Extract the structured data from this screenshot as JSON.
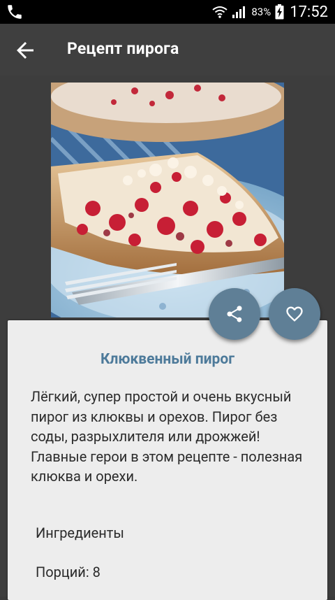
{
  "status_bar": {
    "battery_percent": "83%",
    "time": "17:52"
  },
  "appbar": {
    "title": "Рецепт пирога"
  },
  "recipe": {
    "title": "Клюквенный пирог",
    "description": "Лёгкий, супер простой и очень вкусный пирог из клюквы и орехов. Пирог без соды, разрыхлителя или дрожжей! Главные герои в этом рецепте - полезная клюква и орехи.",
    "ingredients_label": "Ингредиенты",
    "servings_label": "Порций: 8"
  },
  "colors": {
    "accent": "#5f7f96",
    "title_color": "#4d7a9a",
    "card_bg": "#ededed",
    "appbar_bg": "#3f3f3f"
  }
}
